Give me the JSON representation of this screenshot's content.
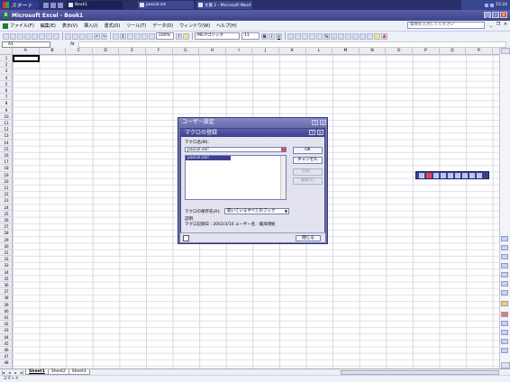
{
  "taskbar": {
    "start_label": "スタート",
    "tasks": [
      {
        "label": "Book1",
        "active": true
      },
      {
        "label": "pascal.xls",
        "active": false
      },
      {
        "label": "文書 1 - Microsoft Word",
        "active": false
      }
    ],
    "clock": "15:24"
  },
  "window": {
    "title": "Microsoft Excel - Book1"
  },
  "menubar": {
    "items": [
      "ファイル(F)",
      "編集(E)",
      "表示(V)",
      "挿入(I)",
      "書式(O)",
      "ツール(T)",
      "データ(D)",
      "ウィンドウ(W)",
      "ヘルプ(H)"
    ],
    "help_placeholder": "質問を入力してください"
  },
  "toolbar": {
    "zoom": "100%",
    "font_name": "MS Pゴシック",
    "font_size": "11",
    "bold": "B",
    "italic": "I",
    "underline": "U"
  },
  "formula_bar": {
    "name_box": "A1",
    "fx": "fx",
    "formula": ""
  },
  "grid": {
    "columns": [
      "A",
      "B",
      "C",
      "D",
      "E",
      "F",
      "G",
      "H",
      "I",
      "J",
      "K",
      "L",
      "M",
      "N",
      "O",
      "P",
      "Q",
      "R"
    ],
    "rows": [
      "1",
      "2",
      "3",
      "4",
      "5",
      "6",
      "7",
      "8",
      "9",
      "10",
      "11",
      "12",
      "13",
      "14",
      "15",
      "16",
      "17",
      "18",
      "19",
      "20",
      "21",
      "22",
      "23",
      "24",
      "25",
      "26",
      "27",
      "28",
      "29",
      "30",
      "31",
      "32",
      "33",
      "34",
      "35",
      "36",
      "37",
      "38",
      "39",
      "40",
      "41",
      "42",
      "43",
      "44",
      "45",
      "46",
      "47",
      "48"
    ],
    "selected_cell": "A1"
  },
  "sheets": {
    "tabs": [
      "Sheet1",
      "Sheet2",
      "Sheet3"
    ],
    "active": "Sheet1"
  },
  "status": "コマンド",
  "user_dialog": {
    "title": "ユーザー設定"
  },
  "macro_dialog": {
    "title": "マクロの登録",
    "macro_name_label": "マクロ名(M):",
    "macro_name_value": "pascal.xls!",
    "macros": [
      "pascal.xls!"
    ],
    "store_label": "マクロの保存先(A):",
    "store_value": "開いているすべてのブック",
    "description_label": "説明",
    "description_text": "マクロ記録日 : 2002/3/10  ユーザー名 : 龍海博紋",
    "buttons": {
      "ok": "OK",
      "cancel": "キャンセル",
      "record": "記録...",
      "edit": "編集(E)"
    },
    "close_label": "閉じる"
  }
}
